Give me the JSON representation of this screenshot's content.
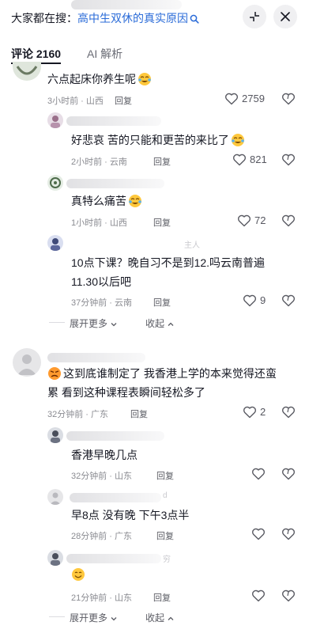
{
  "search": {
    "prefix": "大家都在搜：",
    "query": "高中生双休的真实原因"
  },
  "tabs": [
    {
      "label": "评论 2160"
    },
    {
      "label": "AI 解析"
    }
  ],
  "comments": [
    {
      "text": "六点起床你养生呢",
      "emoji": "cry-laugh",
      "time": "3小时前 · 山西",
      "reply": "回复",
      "likes": "2759"
    },
    {
      "text": "好悲哀 苦的只能和更苦的来比了",
      "emoji": "cry-laugh",
      "time": "2小时前 · 云南",
      "reply": "回复",
      "likes": "821"
    },
    {
      "text": "真特么痛苦",
      "emoji": "cry-laugh",
      "time": "1小时前 · 山西",
      "reply": "回复",
      "likes": "72"
    },
    {
      "tag": "主人",
      "text_line1": "10点下课？晚自习不是到12.吗云南普遍",
      "text_line2": "11.30以后吧",
      "time": "37分钟前 · 云南",
      "reply": "回复",
      "likes": "9"
    },
    {
      "text_line1": "这到底谁制定了 我香港上学的本来觉得还蛮",
      "text_line2": "累 看到这种课程表瞬间轻松多了",
      "emoji": "angry",
      "time": "32分钟前 · 广东",
      "reply": "回复",
      "likes": "2"
    },
    {
      "text": "香港早晚几点",
      "time": "32分钟前 · 山东",
      "reply": "回复"
    },
    {
      "tag": "d",
      "text": "早8点 没有晚 下午3点半",
      "time": "28分钟前 · 广东",
      "reply": "回复"
    },
    {
      "tag": "穷",
      "emoji": "smile",
      "time": "21分钟前 · 山东",
      "reply": "回复"
    }
  ],
  "thread_actions": {
    "expand": "展开更多",
    "collapse": "收起"
  },
  "colors": {
    "highlight": "#2a6bd8",
    "text": "#161823",
    "meta": "#8a8b91"
  }
}
